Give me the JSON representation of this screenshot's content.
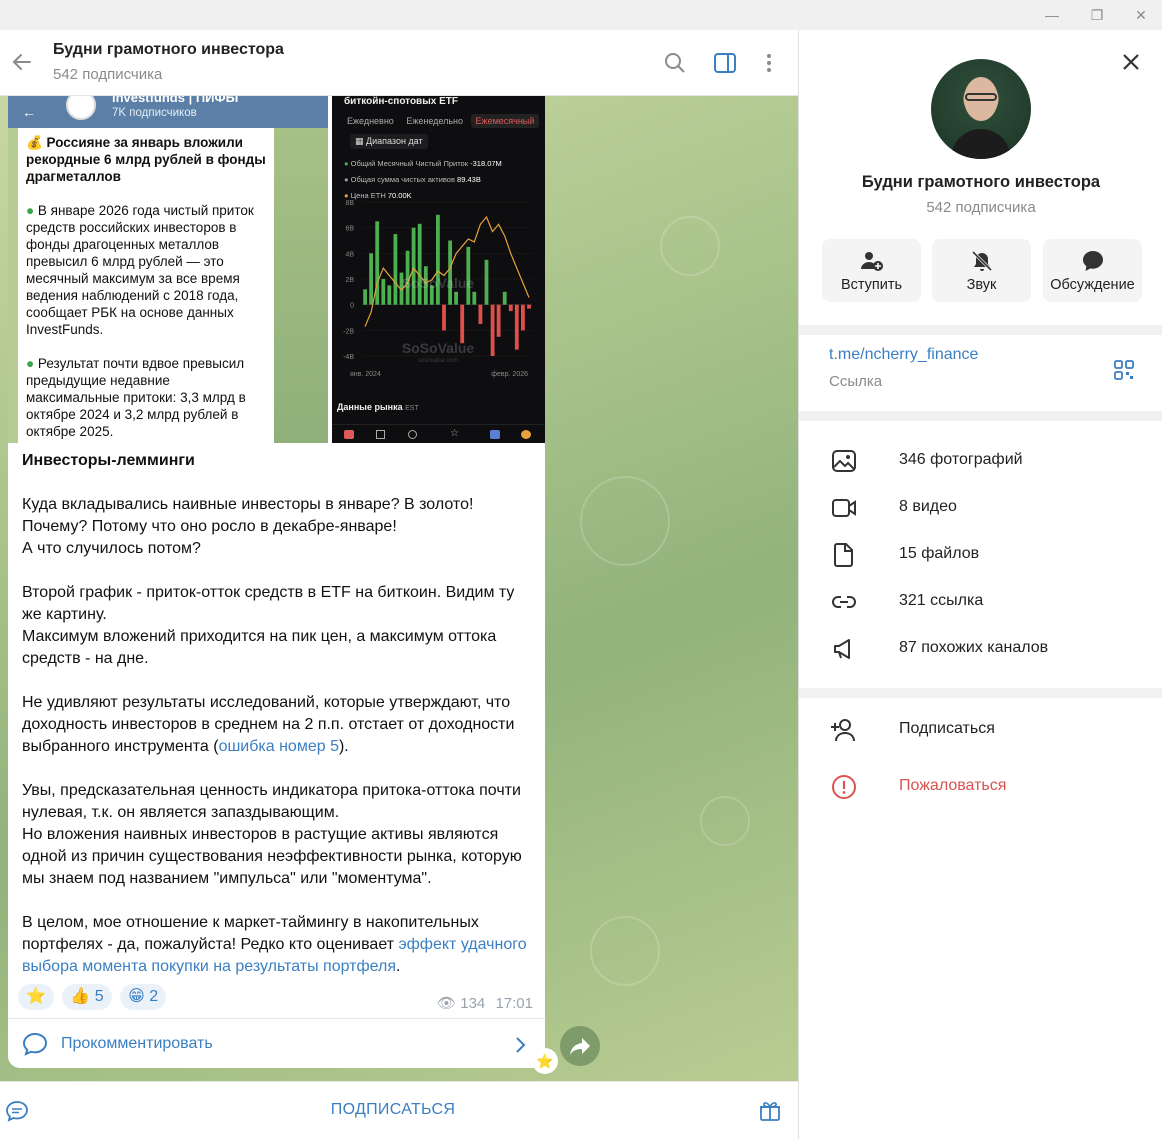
{
  "window": {
    "minimize": "—",
    "maximize": "❐",
    "close": "✕"
  },
  "chat_header": {
    "title": "Будни грамотного инвестора",
    "subtitle": "542 подписчика"
  },
  "message": {
    "embed_left": {
      "channel_name": "investfunds | ПИФЫ",
      "channel_sub": "7K подписчиков",
      "headline": "💰 Россияне за январь вложили рекордные 6 млрд рублей в фонды драгметаллов",
      "para1": "В январе 2026 года чистый приток средств российских инвесторов в фонды драгоценных металлов превысил 6 млрд рублей — это месячный максимум за все время ведения наблюдений с 2018 года, сообщает РБК на основе данных InvestFunds.",
      "para2": "Результат почти вдвое превысил предыдущие недавние максимальные притоки: 3,3 млрд в октябре 2024 и 3,2 млрд рублей в октябре 2025."
    },
    "embed_right": {
      "title": "биткойн-спотовых ETF",
      "tabs": [
        "Ежедневно",
        "Еженедельно",
        "Ежемесячный"
      ],
      "date_range": "Диапазон дат",
      "legend": [
        {
          "label": "Общий Месячный Чистый Приток",
          "value": "-318.07M",
          "color": "#4caf50"
        },
        {
          "label": "Общая сумма чистых активов",
          "value": "89.43B",
          "color": "#9e9e9e"
        },
        {
          "label": "Цена ETH",
          "value": "70.00K",
          "color": "#e6a23c"
        }
      ],
      "y_ticks": [
        "8B",
        "6B",
        "4B",
        "2B",
        "0",
        "-2B",
        "-4B"
      ],
      "x_ticks": [
        "янв. 2024",
        "февр. 2026"
      ],
      "watermark": "SoSoValue",
      "watermark_sub": "sosovalue.com",
      "footer": "Данные рынка",
      "footer_tag": "EST"
    },
    "title": "Инвесторы-лемминги",
    "p1_l1": "Куда вкладывались наивные инвесторы в январе? В золото!",
    "p1_l2": "Почему? Потому что оно росло в декабре-январе!",
    "p1_l3": "А что случилось потом?",
    "p2_l1": "Второй график - приток-отток средств в ETF на биткоин. Видим ту же картину.",
    "p2_l2": "Максимум вложений приходится на пик цен, а максимум оттока средств - на дне.",
    "p3_pre": "Не удивляют результаты исследований, которые утверждают, что доходность инвесторов в среднем на 2 п.п. отстает от доходности выбранного инструмента (",
    "p3_link": "ошибка номер 5",
    "p3_post": ").",
    "p4_l1": "Увы, предсказательная ценность индикатора притока-оттока почти нулевая, т.к. он является запаздывающим.",
    "p4_l2": "Но вложения наивных инвесторов в растущие активы являются одной из причин существования неэффективности рынка, которую мы знаем под названием \"импульса\" или \"моментума\".",
    "p5_pre": "В целом, мое отношение к маркет-таймингу в накопительных портфелях - да, пожалуйста! Редко кто оценивает ",
    "p5_link": "эффект удачного выбора момента покупки на результаты портфеля",
    "p5_post": ".",
    "reactions": [
      {
        "emoji": "⭐",
        "count": ""
      },
      {
        "emoji": "👍",
        "count": "5"
      },
      {
        "emoji": "😁",
        "count": "2"
      }
    ],
    "views": "134",
    "time": "17:01",
    "comment_label": "Прокомментировать"
  },
  "bottom_bar": {
    "subscribe": "ПОДПИСАТЬСЯ"
  },
  "right_panel": {
    "title": "Будни грамотного инвестора",
    "subtitle": "542 подписчика",
    "actions": [
      "Вступить",
      "Звук",
      "Обсуждение"
    ],
    "link": "t.me/ncherry_finance",
    "link_label": "Ссылка",
    "media": [
      "346 фотографий",
      "8 видео",
      "15 файлов",
      "321 ссылка",
      "87 похожих каналов"
    ],
    "subscribe": "Подписаться",
    "report": "Пожаловаться"
  },
  "colors": {
    "accent": "#3a7fc2",
    "danger": "#d9534f"
  },
  "chart_data": {
    "type": "bar",
    "values_approx_B": [
      1.2,
      4.0,
      6.5,
      2.0,
      1.5,
      5.5,
      2.5,
      4.2,
      6.0,
      6.3,
      3.0,
      1.5,
      7.0,
      -2.0,
      5.0,
      1.0,
      -3.0,
      4.5,
      1.0,
      -1.5,
      3.5,
      -4.0,
      -2.5,
      1.0,
      -0.5,
      -3.5,
      -2.0,
      -0.3
    ],
    "ylim": [
      -4,
      8
    ]
  }
}
